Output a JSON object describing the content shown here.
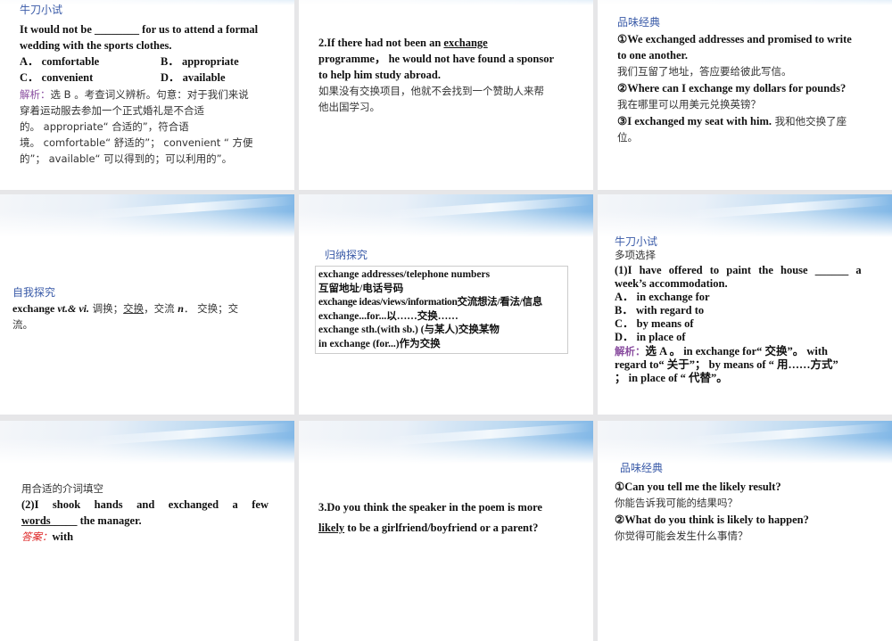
{
  "slides": [
    {
      "heading": "牛刀小试",
      "question": [
        "It would not be ________ for us to attend a formal",
        "wedding with the sports clothes."
      ],
      "options": [
        "A． comfortable",
        "B． appropriate",
        "C． convenient",
        "D． available"
      ],
      "analysis_label": "解析：",
      "analysis": [
        "选 B 。考查词义辨析。句意：对于我们来说",
        "穿着运动服去参加一个正式婚礼是不合适",
        "的。 appropriate“ 合适的”，符合语",
        "境。 comfortable“ 舒适的”； convenient “ 方便",
        "的”； available“ 可以得到的；可以利用的”。"
      ]
    },
    {
      "sentence_pre": "2.If there had not been an ",
      "sentence_underlined": "exchange",
      "sentence_rest": [
        "programme， he would not have found a sponsor",
        "to help him study abroad."
      ],
      "translation": [
        "如果没有交换项目，他就不会找到一个赞助人来帮",
        "他出国学习。"
      ]
    },
    {
      "heading": "品味经典",
      "lines": [
        {
          "t": "①We exchanged addresses and promised to write",
          "s": "b"
        },
        {
          "t": "to one another.",
          "s": "b"
        },
        {
          "t": "我们互留了地址，答应要给彼此写信。",
          "s": "zh"
        },
        {
          "t": "②Where can I exchange my dollars for pounds?",
          "s": "b"
        },
        {
          "t": "我在哪里可以用美元兑换英镑？",
          "s": "zh"
        }
      ],
      "last_en": "③I exchanged my seat with him.",
      "last_zh": " 我和他交换了座",
      "last_zh2": "位。"
    },
    {
      "heading": "自我探究",
      "word": "exchange ",
      "pos": "vt.& vi.",
      "m1": " 调换；",
      "m2": "交换",
      "m3": "，交流 ",
      "pos2": "n",
      "m4": "． 交换；交",
      "m5": "流。"
    },
    {
      "heading": "归纳探究",
      "phrases": [
        "exchange addresses/telephone numbers",
        "互留地址/电话号码",
        "exchange ideas/views/information交流想法/看法/信息",
        "exchange...for...以……交换……",
        "exchange sth.(with sb.) (与某人)交换某物",
        "in exchange (for...)作为交换"
      ]
    },
    {
      "heading": "牛刀小试",
      "sub": "多项选择",
      "question": "(1)I have offered to paint the house ______ a",
      "question2": "week’s accommodation.",
      "options": [
        "A． in exchange for",
        "B． with regard to",
        "C． by means of",
        "D． in place of"
      ],
      "analysis_label": "解析：",
      "analysis": [
        "选 A 。 in exchange for“ 交换”。 with",
        "regard to“ 关于”； by means of “ 用……方式”",
        "； in place of “ 代替”。"
      ]
    },
    {
      "heading": "用合适的介词填空",
      "question": "(2)I shook hands and exchanged a few words",
      "question2": "__________ the manager.",
      "answer_label": "答案：",
      "answer": "with"
    },
    {
      "line1": "3.Do you think the speaker in the poem is more",
      "underlined": "likely",
      "line2_rest": " to be a girlfriend/boyfriend or a parent?"
    },
    {
      "heading": "品味经典",
      "lines": [
        "①Can you tell me the likely result?",
        "你能告诉我可能的结果吗？",
        "②What do you think is likely to happen?",
        "你觉得可能会发生什么事情？"
      ]
    }
  ]
}
